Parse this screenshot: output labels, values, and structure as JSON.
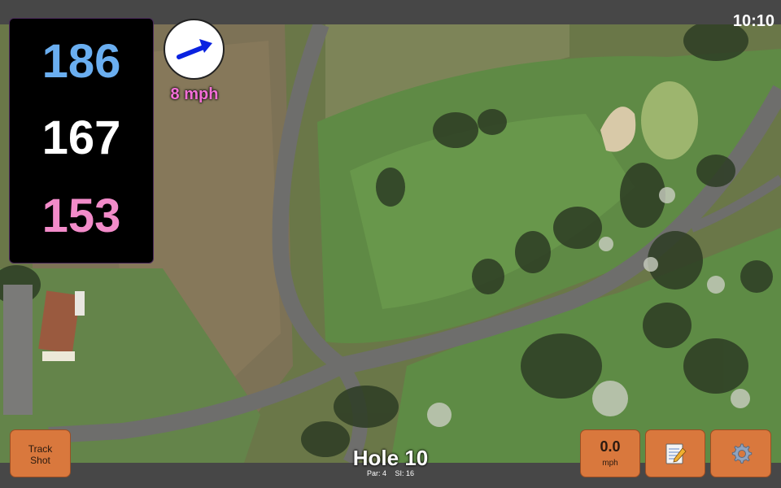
{
  "clock": "10:10",
  "distances": {
    "back": "186",
    "middle": "167",
    "front": "153"
  },
  "wind": {
    "speed": "8 mph",
    "arrow_color": "#0a22e0"
  },
  "buttons": {
    "track_shot": "Track\nShot",
    "speed_value": "0.0",
    "speed_unit": "mph",
    "notes_icon": "notepad-icon",
    "settings_icon": "gear-icon"
  },
  "hole": {
    "title": "Hole 10",
    "par": "Par: 4",
    "si": "SI: 16"
  },
  "colors": {
    "back_distance": "#6aaef0",
    "middle_distance": "#ffffff",
    "front_distance": "#f28bc9",
    "wind_text": "#f36fd7",
    "button": "#d9783d"
  }
}
